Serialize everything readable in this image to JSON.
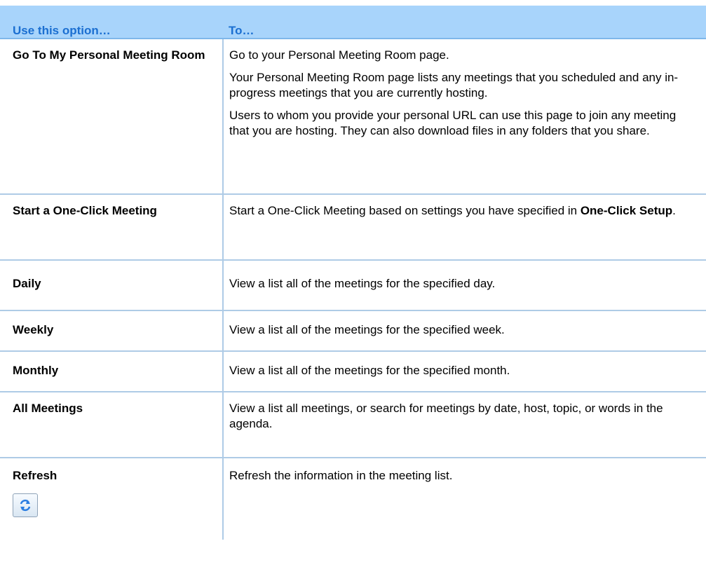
{
  "header": {
    "col1": "Use this option…",
    "col2": "To…"
  },
  "rows": [
    {
      "option": "Go To My Personal Meeting Room",
      "paragraphs": [
        "Go to your Personal Meeting Room page.",
        "Your Personal Meeting Room page lists any meetings that you scheduled and any in-progress meetings that you are currently hosting.",
        "Users to whom you provide your personal URL can use this page to join any meeting that you are hosting. They can also download files in any folders that you share."
      ]
    },
    {
      "option": "Start a One-Click Meeting",
      "desc_pre": "Start a One-Click Meeting based on settings you have specified in ",
      "desc_bold": "One-Click Setup",
      "desc_post": "."
    },
    {
      "option": "Daily",
      "desc": "View a list all of the meetings for the specified day."
    },
    {
      "option": "Weekly",
      "desc": "View a list all of the meetings for the specified week."
    },
    {
      "option": "Monthly",
      "desc": "View a list all of the meetings for the specified month."
    },
    {
      "option": "All Meetings",
      "desc": "View a list all meetings, or search for meetings by date, host, topic, or words in the agenda."
    },
    {
      "option": "Refresh",
      "desc": "Refresh the information in the meeting list.",
      "icon": "refresh-icon"
    }
  ],
  "colors": {
    "header_bg": "#a8d4fb",
    "header_text": "#1b6fd1",
    "divider": "#aecbe6"
  }
}
